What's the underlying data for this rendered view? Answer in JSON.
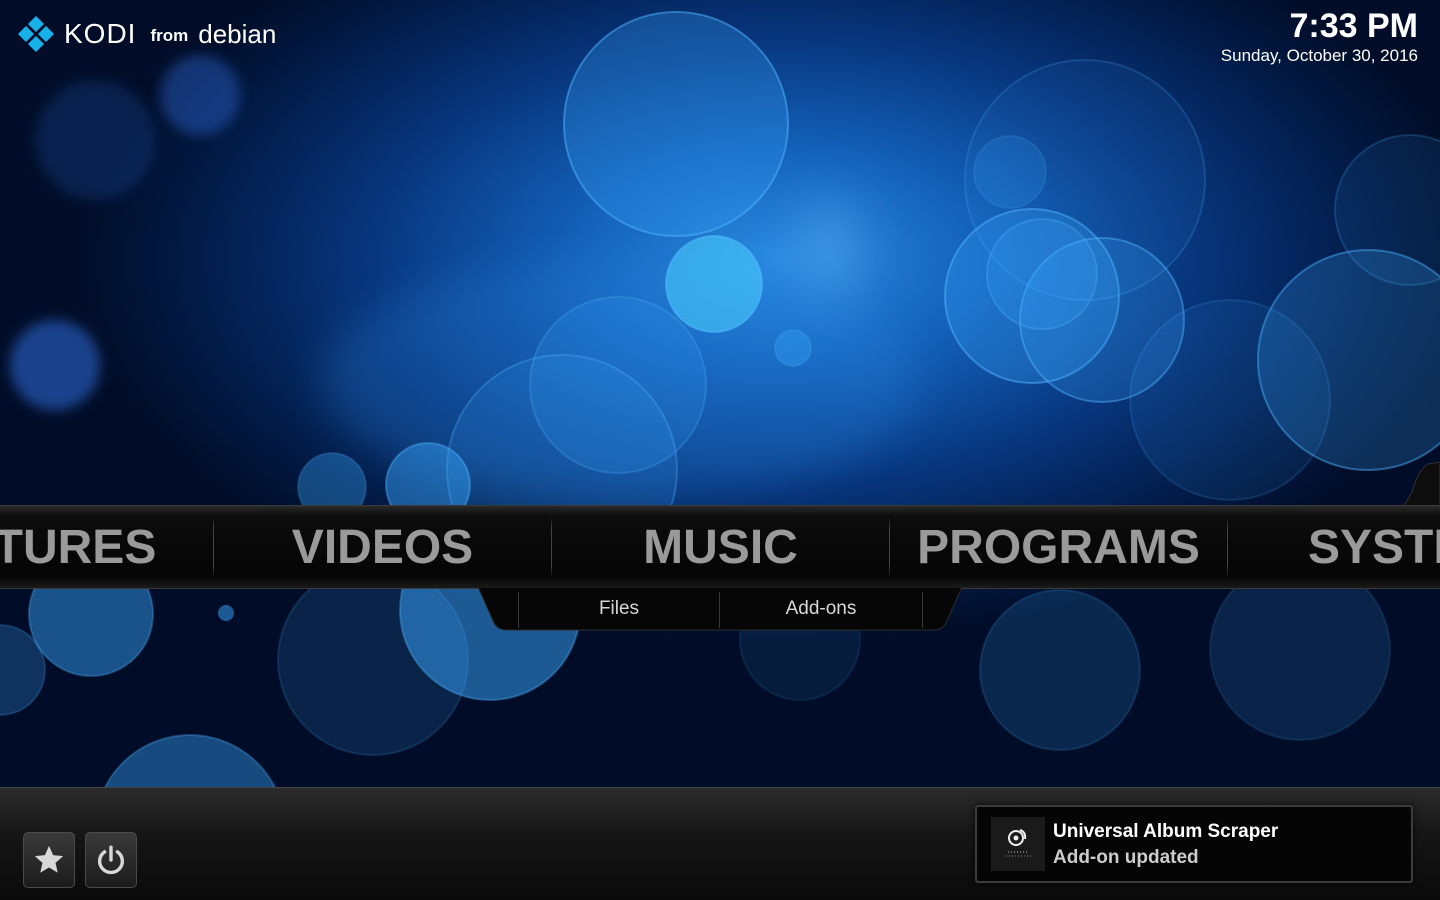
{
  "brand": {
    "name": "KODI",
    "from": "from",
    "distro": "debian"
  },
  "clock": {
    "time": "7:33 PM",
    "date": "Sunday, October 30, 2016"
  },
  "main_menu": {
    "items": [
      {
        "label": "TURES",
        "full_label": "PICTURES"
      },
      {
        "label": "VIDEOS"
      },
      {
        "label": "MUSIC"
      },
      {
        "label": "PROGRAMS"
      },
      {
        "label": "SYSTE",
        "full_label": "SYSTEM"
      }
    ],
    "selected": "MUSIC"
  },
  "submenu": {
    "items": [
      {
        "label": "Files"
      },
      {
        "label": "Add-ons"
      }
    ]
  },
  "bottom_buttons": {
    "favourites_icon": "star-icon",
    "power_icon": "power-icon"
  },
  "notification": {
    "title": "Universal Album Scraper",
    "message": "Add-on updated",
    "icon": "album-scraper-icon"
  },
  "colors": {
    "accent": "#1d6fd0",
    "logo_blue": "#17b2e7",
    "menu_text": "#9a9a9a"
  }
}
